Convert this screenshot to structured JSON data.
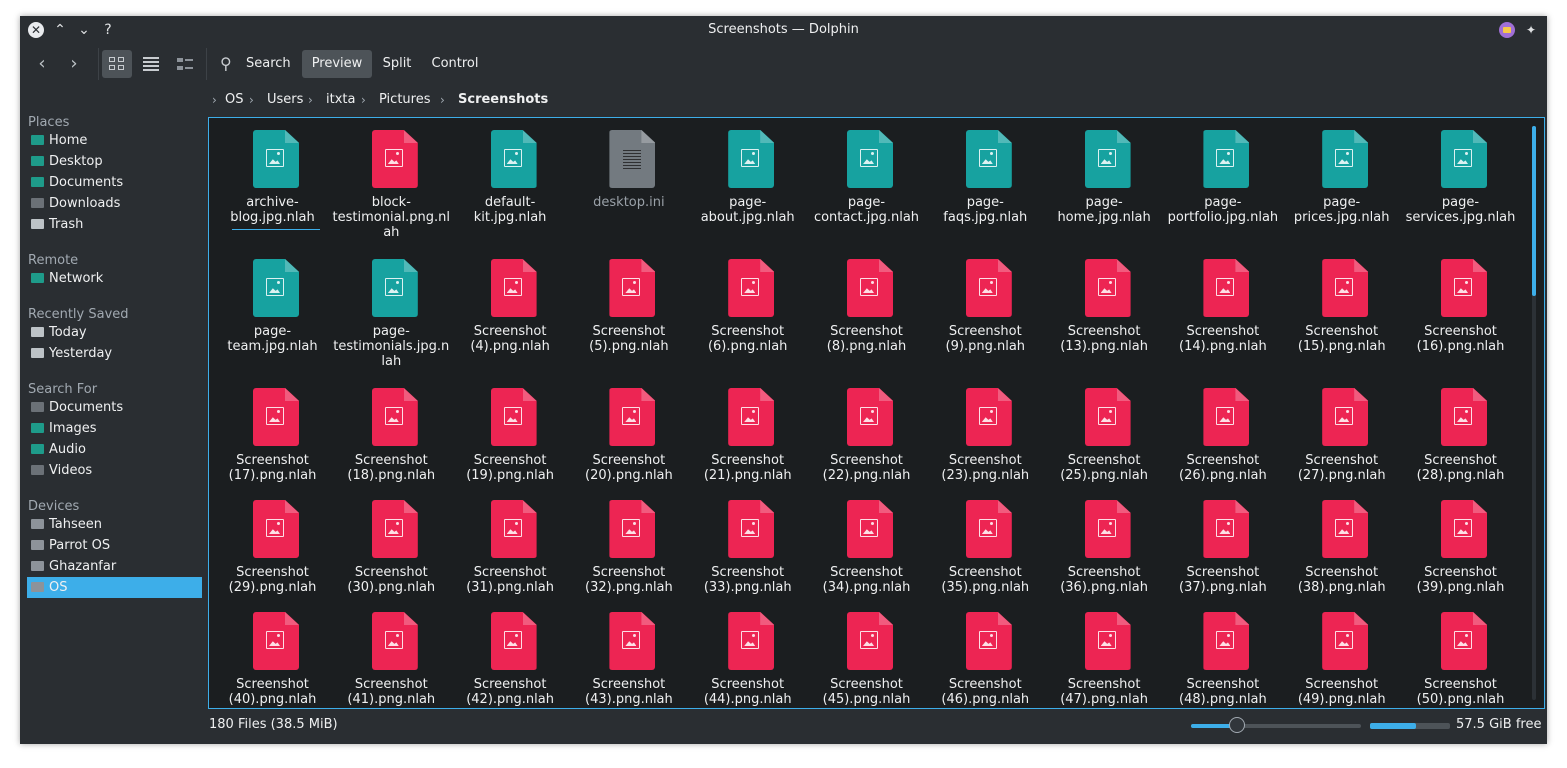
{
  "window": {
    "title": "Screenshots — Dolphin",
    "buttons": {
      "close": "✕",
      "up": "⌃",
      "down": "⌄",
      "help": "?"
    }
  },
  "toolbar": {
    "back": "‹",
    "forward": "›",
    "search": "Search",
    "preview": "Preview",
    "split": "Split",
    "control": "Control"
  },
  "sidebar": {
    "sections": [
      {
        "title": "Places",
        "items": [
          {
            "label": "Home",
            "icon": "home-folder-icon",
            "color": "#1e9b8a"
          },
          {
            "label": "Desktop",
            "icon": "desktop-folder-icon",
            "color": "#1e9b8a"
          },
          {
            "label": "Documents",
            "icon": "documents-folder-icon",
            "color": "#1e9b8a"
          },
          {
            "label": "Downloads",
            "icon": "downloads-folder-icon",
            "color": "#6b7177"
          },
          {
            "label": "Trash",
            "icon": "trash-icon",
            "color": "#bdc3c7"
          }
        ]
      },
      {
        "title": "Remote",
        "items": [
          {
            "label": "Network",
            "icon": "network-folder-icon",
            "color": "#1e9b8a"
          }
        ]
      },
      {
        "title": "Recently Saved",
        "items": [
          {
            "label": "Today",
            "icon": "recent-icon",
            "color": "#bdc3c7"
          },
          {
            "label": "Yesterday",
            "icon": "recent-doc-icon",
            "color": "#bdc3c7"
          }
        ]
      },
      {
        "title": "Search For",
        "items": [
          {
            "label": "Documents",
            "icon": "documents-folder-icon",
            "color": "#6b7177"
          },
          {
            "label": "Images",
            "icon": "images-folder-icon",
            "color": "#1e9b8a"
          },
          {
            "label": "Audio",
            "icon": "audio-folder-icon",
            "color": "#1e9b8a"
          },
          {
            "label": "Videos",
            "icon": "videos-icon",
            "color": "#6b7177"
          }
        ]
      },
      {
        "title": "Devices",
        "items": [
          {
            "label": "Tahseen",
            "icon": "drive-icon",
            "color": "#8d939a"
          },
          {
            "label": "Parrot OS",
            "icon": "drive-icon",
            "color": "#8d939a"
          },
          {
            "label": "Ghazanfar",
            "icon": "drive-icon",
            "color": "#8d939a"
          },
          {
            "label": "OS",
            "icon": "drive-icon",
            "color": "#8d939a",
            "selected": true
          }
        ]
      }
    ]
  },
  "breadcrumb": {
    "items": [
      "OS",
      "Users",
      "itxta",
      "Pictures",
      "Screenshots"
    ]
  },
  "files": [
    {
      "name": "archive-blog.jpg.nlah",
      "kind": "teal"
    },
    {
      "name": "block-testimonial.png.nlah",
      "kind": "red"
    },
    {
      "name": "default-kit.jpg.nlah",
      "kind": "teal"
    },
    {
      "name": "desktop.ini",
      "kind": "grey"
    },
    {
      "name": "page-about.jpg.nlah",
      "kind": "teal"
    },
    {
      "name": "page-contact.jpg.nlah",
      "kind": "teal"
    },
    {
      "name": "page-faqs.jpg.nlah",
      "kind": "teal"
    },
    {
      "name": "page-home.jpg.nlah",
      "kind": "teal"
    },
    {
      "name": "page-portfolio.jpg.nlah",
      "kind": "teal"
    },
    {
      "name": "page-prices.jpg.nlah",
      "kind": "teal"
    },
    {
      "name": "page-services.jpg.nlah",
      "kind": "teal"
    },
    {
      "name": "page-team.jpg.nlah",
      "kind": "teal"
    },
    {
      "name": "page-testimonials.jpg.nlah",
      "kind": "teal"
    },
    {
      "name": "Screenshot (4).png.nlah",
      "kind": "red"
    },
    {
      "name": "Screenshot (5).png.nlah",
      "kind": "red"
    },
    {
      "name": "Screenshot (6).png.nlah",
      "kind": "red"
    },
    {
      "name": "Screenshot (8).png.nlah",
      "kind": "red"
    },
    {
      "name": "Screenshot (9).png.nlah",
      "kind": "red"
    },
    {
      "name": "Screenshot (13).png.nlah",
      "kind": "red"
    },
    {
      "name": "Screenshot (14).png.nlah",
      "kind": "red"
    },
    {
      "name": "Screenshot (15).png.nlah",
      "kind": "red"
    },
    {
      "name": "Screenshot (16).png.nlah",
      "kind": "red"
    },
    {
      "name": "Screenshot (17).png.nlah",
      "kind": "red"
    },
    {
      "name": "Screenshot (18).png.nlah",
      "kind": "red"
    },
    {
      "name": "Screenshot (19).png.nlah",
      "kind": "red"
    },
    {
      "name": "Screenshot (20).png.nlah",
      "kind": "red"
    },
    {
      "name": "Screenshot (21).png.nlah",
      "kind": "red"
    },
    {
      "name": "Screenshot (22).png.nlah",
      "kind": "red"
    },
    {
      "name": "Screenshot (23).png.nlah",
      "kind": "red"
    },
    {
      "name": "Screenshot (25).png.nlah",
      "kind": "red"
    },
    {
      "name": "Screenshot (26).png.nlah",
      "kind": "red"
    },
    {
      "name": "Screenshot (27).png.nlah",
      "kind": "red"
    },
    {
      "name": "Screenshot (28).png.nlah",
      "kind": "red"
    },
    {
      "name": "Screenshot (29).png.nlah",
      "kind": "red"
    },
    {
      "name": "Screenshot (30).png.nlah",
      "kind": "red"
    },
    {
      "name": "Screenshot (31).png.nlah",
      "kind": "red"
    },
    {
      "name": "Screenshot (32).png.nlah",
      "kind": "red"
    },
    {
      "name": "Screenshot (33).png.nlah",
      "kind": "red"
    },
    {
      "name": "Screenshot (34).png.nlah",
      "kind": "red"
    },
    {
      "name": "Screenshot (35).png.nlah",
      "kind": "red"
    },
    {
      "name": "Screenshot (36).png.nlah",
      "kind": "red"
    },
    {
      "name": "Screenshot (37).png.nlah",
      "kind": "red"
    },
    {
      "name": "Screenshot (38).png.nlah",
      "kind": "red"
    },
    {
      "name": "Screenshot (39).png.nlah",
      "kind": "red"
    },
    {
      "name": "Screenshot (40).png.nlah",
      "kind": "red"
    },
    {
      "name": "Screenshot (41).png.nlah",
      "kind": "red"
    },
    {
      "name": "Screenshot (42).png.nlah",
      "kind": "red"
    },
    {
      "name": "Screenshot (43).png.nlah",
      "kind": "red"
    },
    {
      "name": "Screenshot (44).png.nlah",
      "kind": "red"
    },
    {
      "name": "Screenshot (45).png.nlah",
      "kind": "red"
    },
    {
      "name": "Screenshot (46).png.nlah",
      "kind": "red"
    },
    {
      "name": "Screenshot (47).png.nlah",
      "kind": "red"
    },
    {
      "name": "Screenshot (48).png.nlah",
      "kind": "red"
    },
    {
      "name": "Screenshot (49).png.nlah",
      "kind": "red"
    },
    {
      "name": "Screenshot (50).png.nlah",
      "kind": "red"
    }
  ],
  "status": {
    "files_summary": "180 Files (38.5 MiB)",
    "zoom_level": 0.27,
    "disk_used_fraction": 0.58,
    "free_space": "57.5 GiB free"
  },
  "colors": {
    "accent": "#3daee9",
    "teal_icon": "#17a2a0",
    "red_icon": "#ed2553",
    "window_bg": "#2a2e32",
    "view_bg": "#1b1e20"
  }
}
